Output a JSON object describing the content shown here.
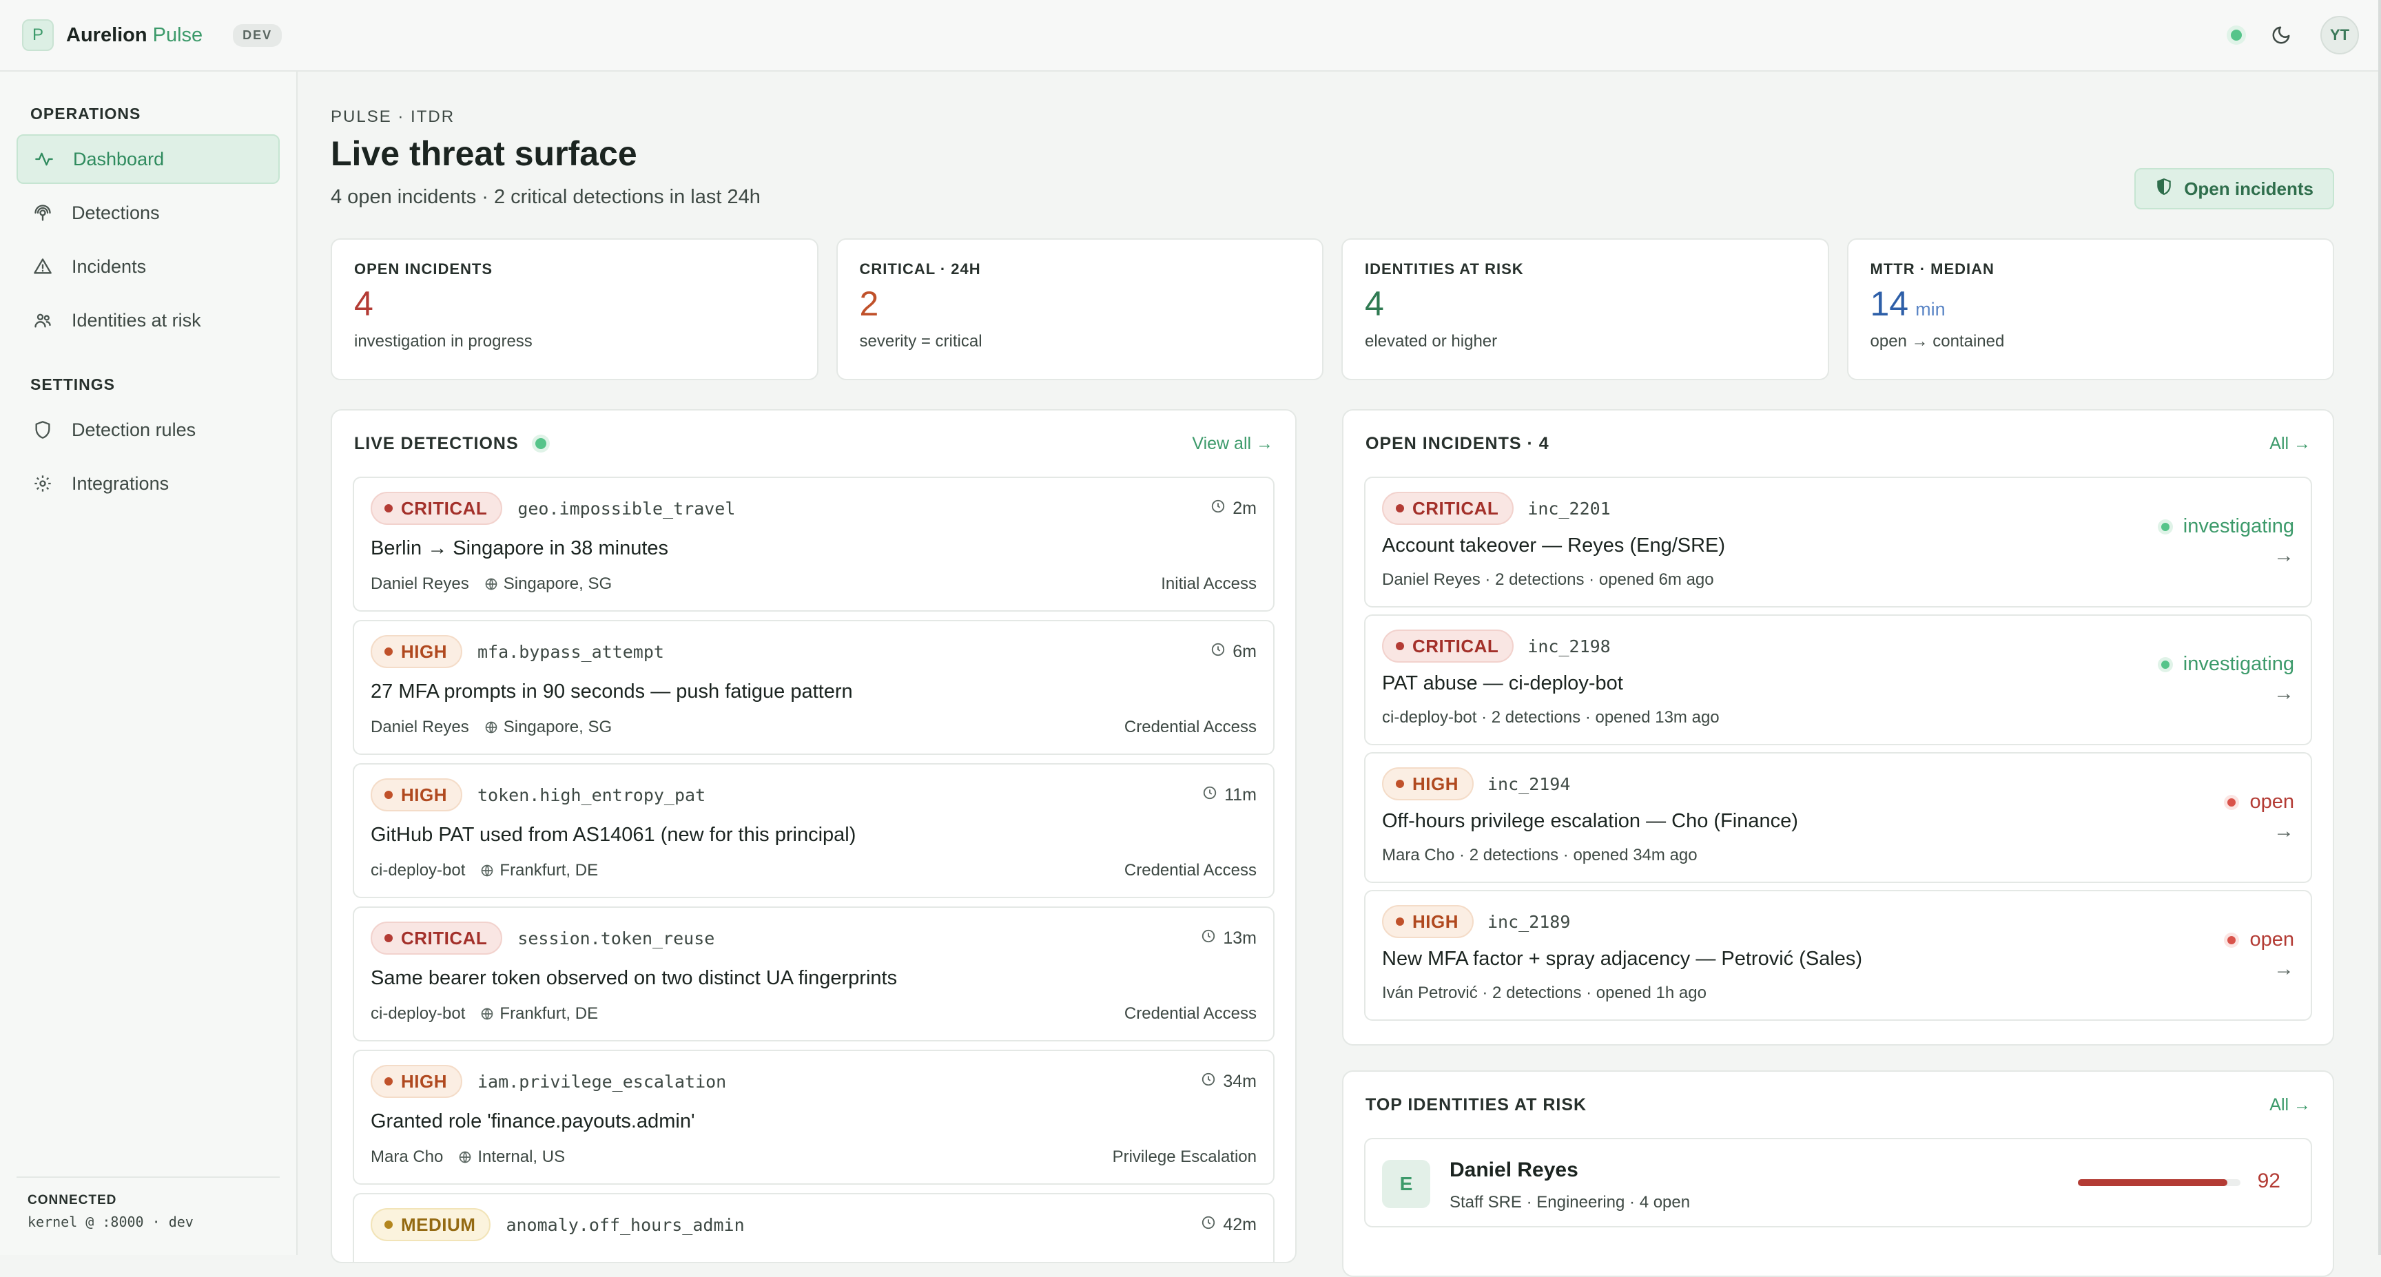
{
  "app": {
    "logo_letter": "P",
    "name": "Aurelion",
    "name_accent": "Pulse",
    "env": "DEV",
    "user_initials": "YT",
    "status": "online"
  },
  "sidebar": {
    "sections": [
      {
        "title": "OPERATIONS",
        "items": [
          {
            "label": "Dashboard",
            "icon": "activity-icon",
            "active": true
          },
          {
            "label": "Detections",
            "icon": "fingerprint-icon"
          },
          {
            "label": "Incidents",
            "icon": "alert-triangle-icon"
          },
          {
            "label": "Identities at risk",
            "icon": "users-icon"
          }
        ]
      },
      {
        "title": "SETTINGS",
        "items": [
          {
            "label": "Detection rules",
            "icon": "shield-icon"
          },
          {
            "label": "Integrations",
            "icon": "gear-icon"
          }
        ]
      }
    ],
    "footer": {
      "label": "CONNECTED",
      "value": "kernel @ :8000 · dev"
    }
  },
  "header": {
    "kicker": "PULSE · ITDR",
    "title": "Live threat surface",
    "subtitle": "4 open incidents · 2 critical detections in last 24h",
    "action_label": "Open incidents"
  },
  "stats": [
    {
      "label": "OPEN INCIDENTS",
      "value": "4",
      "unit": "",
      "desc": "investigation in progress",
      "color": "#b33b34"
    },
    {
      "label": "CRITICAL · 24H",
      "value": "2",
      "unit": "",
      "desc": "severity = critical",
      "color": "#c0512a"
    },
    {
      "label": "IDENTITIES AT RISK",
      "value": "4",
      "unit": "",
      "desc": "elevated or higher",
      "color": "#2f7a52"
    },
    {
      "label": "MTTR · MEDIAN",
      "value": "14",
      "unit": "min",
      "desc": "open → contained",
      "color": "#2e5fa8"
    }
  ],
  "detections": {
    "title": "LIVE DETECTIONS",
    "link": "View all →",
    "items": [
      {
        "severity": "CRITICAL",
        "level": "critical",
        "rule": "geo.impossible_travel",
        "time": "2m",
        "title": "Berlin → Singapore in 38 minutes",
        "principal": "Daniel Reyes",
        "location": "Singapore, SG",
        "tactic": "Initial Access"
      },
      {
        "severity": "HIGH",
        "level": "high",
        "rule": "mfa.bypass_attempt",
        "time": "6m",
        "title": "27 MFA prompts in 90 seconds — push fatigue pattern",
        "principal": "Daniel Reyes",
        "location": "Singapore, SG",
        "tactic": "Credential Access"
      },
      {
        "severity": "HIGH",
        "level": "high",
        "rule": "token.high_entropy_pat",
        "time": "11m",
        "title": "GitHub PAT used from AS14061 (new for this principal)",
        "principal": "ci-deploy-bot",
        "location": "Frankfurt, DE",
        "tactic": "Credential Access"
      },
      {
        "severity": "CRITICAL",
        "level": "critical",
        "rule": "session.token_reuse",
        "time": "13m",
        "title": "Same bearer token observed on two distinct UA fingerprints",
        "principal": "ci-deploy-bot",
        "location": "Frankfurt, DE",
        "tactic": "Credential Access"
      },
      {
        "severity": "HIGH",
        "level": "high",
        "rule": "iam.privilege_escalation",
        "time": "34m",
        "title": "Granted role 'finance.payouts.admin'",
        "principal": "Mara Cho",
        "location": "Internal, US",
        "tactic": "Privilege Escalation"
      },
      {
        "severity": "MEDIUM",
        "level": "medium",
        "rule": "anomaly.off_hours_admin",
        "time": "42m",
        "title": "",
        "principal": "",
        "location": "",
        "tactic": ""
      }
    ]
  },
  "incidents": {
    "title": "OPEN INCIDENTS · 4",
    "link": "All →",
    "items": [
      {
        "severity": "CRITICAL",
        "level": "critical",
        "id": "inc_2201",
        "title": "Account takeover — Reyes (Eng/SRE)",
        "meta": "Daniel Reyes · 2 detections · opened 6m ago",
        "status": "investigating"
      },
      {
        "severity": "CRITICAL",
        "level": "critical",
        "id": "inc_2198",
        "title": "PAT abuse — ci-deploy-bot",
        "meta": "ci-deploy-bot · 2 detections · opened 13m ago",
        "status": "investigating"
      },
      {
        "severity": "HIGH",
        "level": "high",
        "id": "inc_2194",
        "title": "Off-hours privilege escalation — Cho (Finance)",
        "meta": "Mara Cho · 2 detections · opened 34m ago",
        "status": "open"
      },
      {
        "severity": "HIGH",
        "level": "high",
        "id": "inc_2189",
        "title": "New MFA factor + spray adjacency — Petrović (Sales)",
        "meta": "Iván Petrović · 2 detections · opened 1h ago",
        "status": "open"
      }
    ]
  },
  "identities": {
    "title": "TOP IDENTITIES AT RISK",
    "link": "All →",
    "items": [
      {
        "initial": "E",
        "name": "Daniel Reyes",
        "sub": "Staff SRE · Engineering · 4 open",
        "score": "92",
        "risk_fraction": 0.92
      }
    ]
  }
}
